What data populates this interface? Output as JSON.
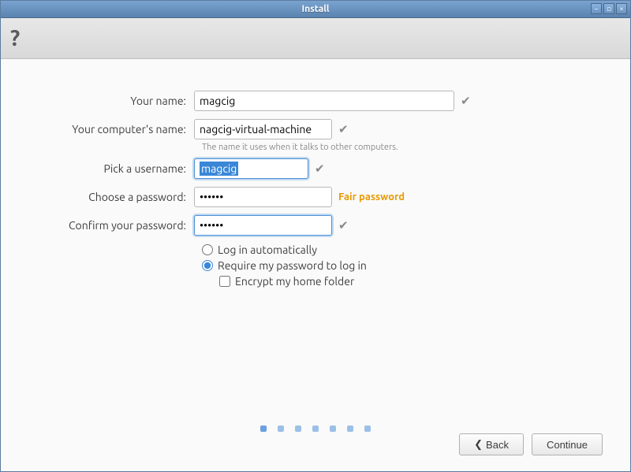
{
  "window": {
    "title": "Install"
  },
  "header": {
    "heading": "?"
  },
  "form": {
    "yourName": {
      "label": "Your name:",
      "value": "magcig"
    },
    "computerName": {
      "label": "Your computer's name:",
      "value": "nagcig-virtual-machine",
      "hint": "The name it uses when it talks to other computers."
    },
    "username": {
      "label": "Pick a username:",
      "value": "magcig"
    },
    "password": {
      "label": "Choose a password:",
      "value": "••••••",
      "strength": "Fair password"
    },
    "confirm": {
      "label": "Confirm your password:",
      "value": "••••••"
    },
    "autoLogin": {
      "label": "Log in automatically",
      "checked": false
    },
    "requirePw": {
      "label": "Require my password to log in",
      "checked": true
    },
    "encrypt": {
      "label": "Encrypt my home folder",
      "checked": false
    }
  },
  "buttons": {
    "back": "Back",
    "continue": "Continue"
  }
}
